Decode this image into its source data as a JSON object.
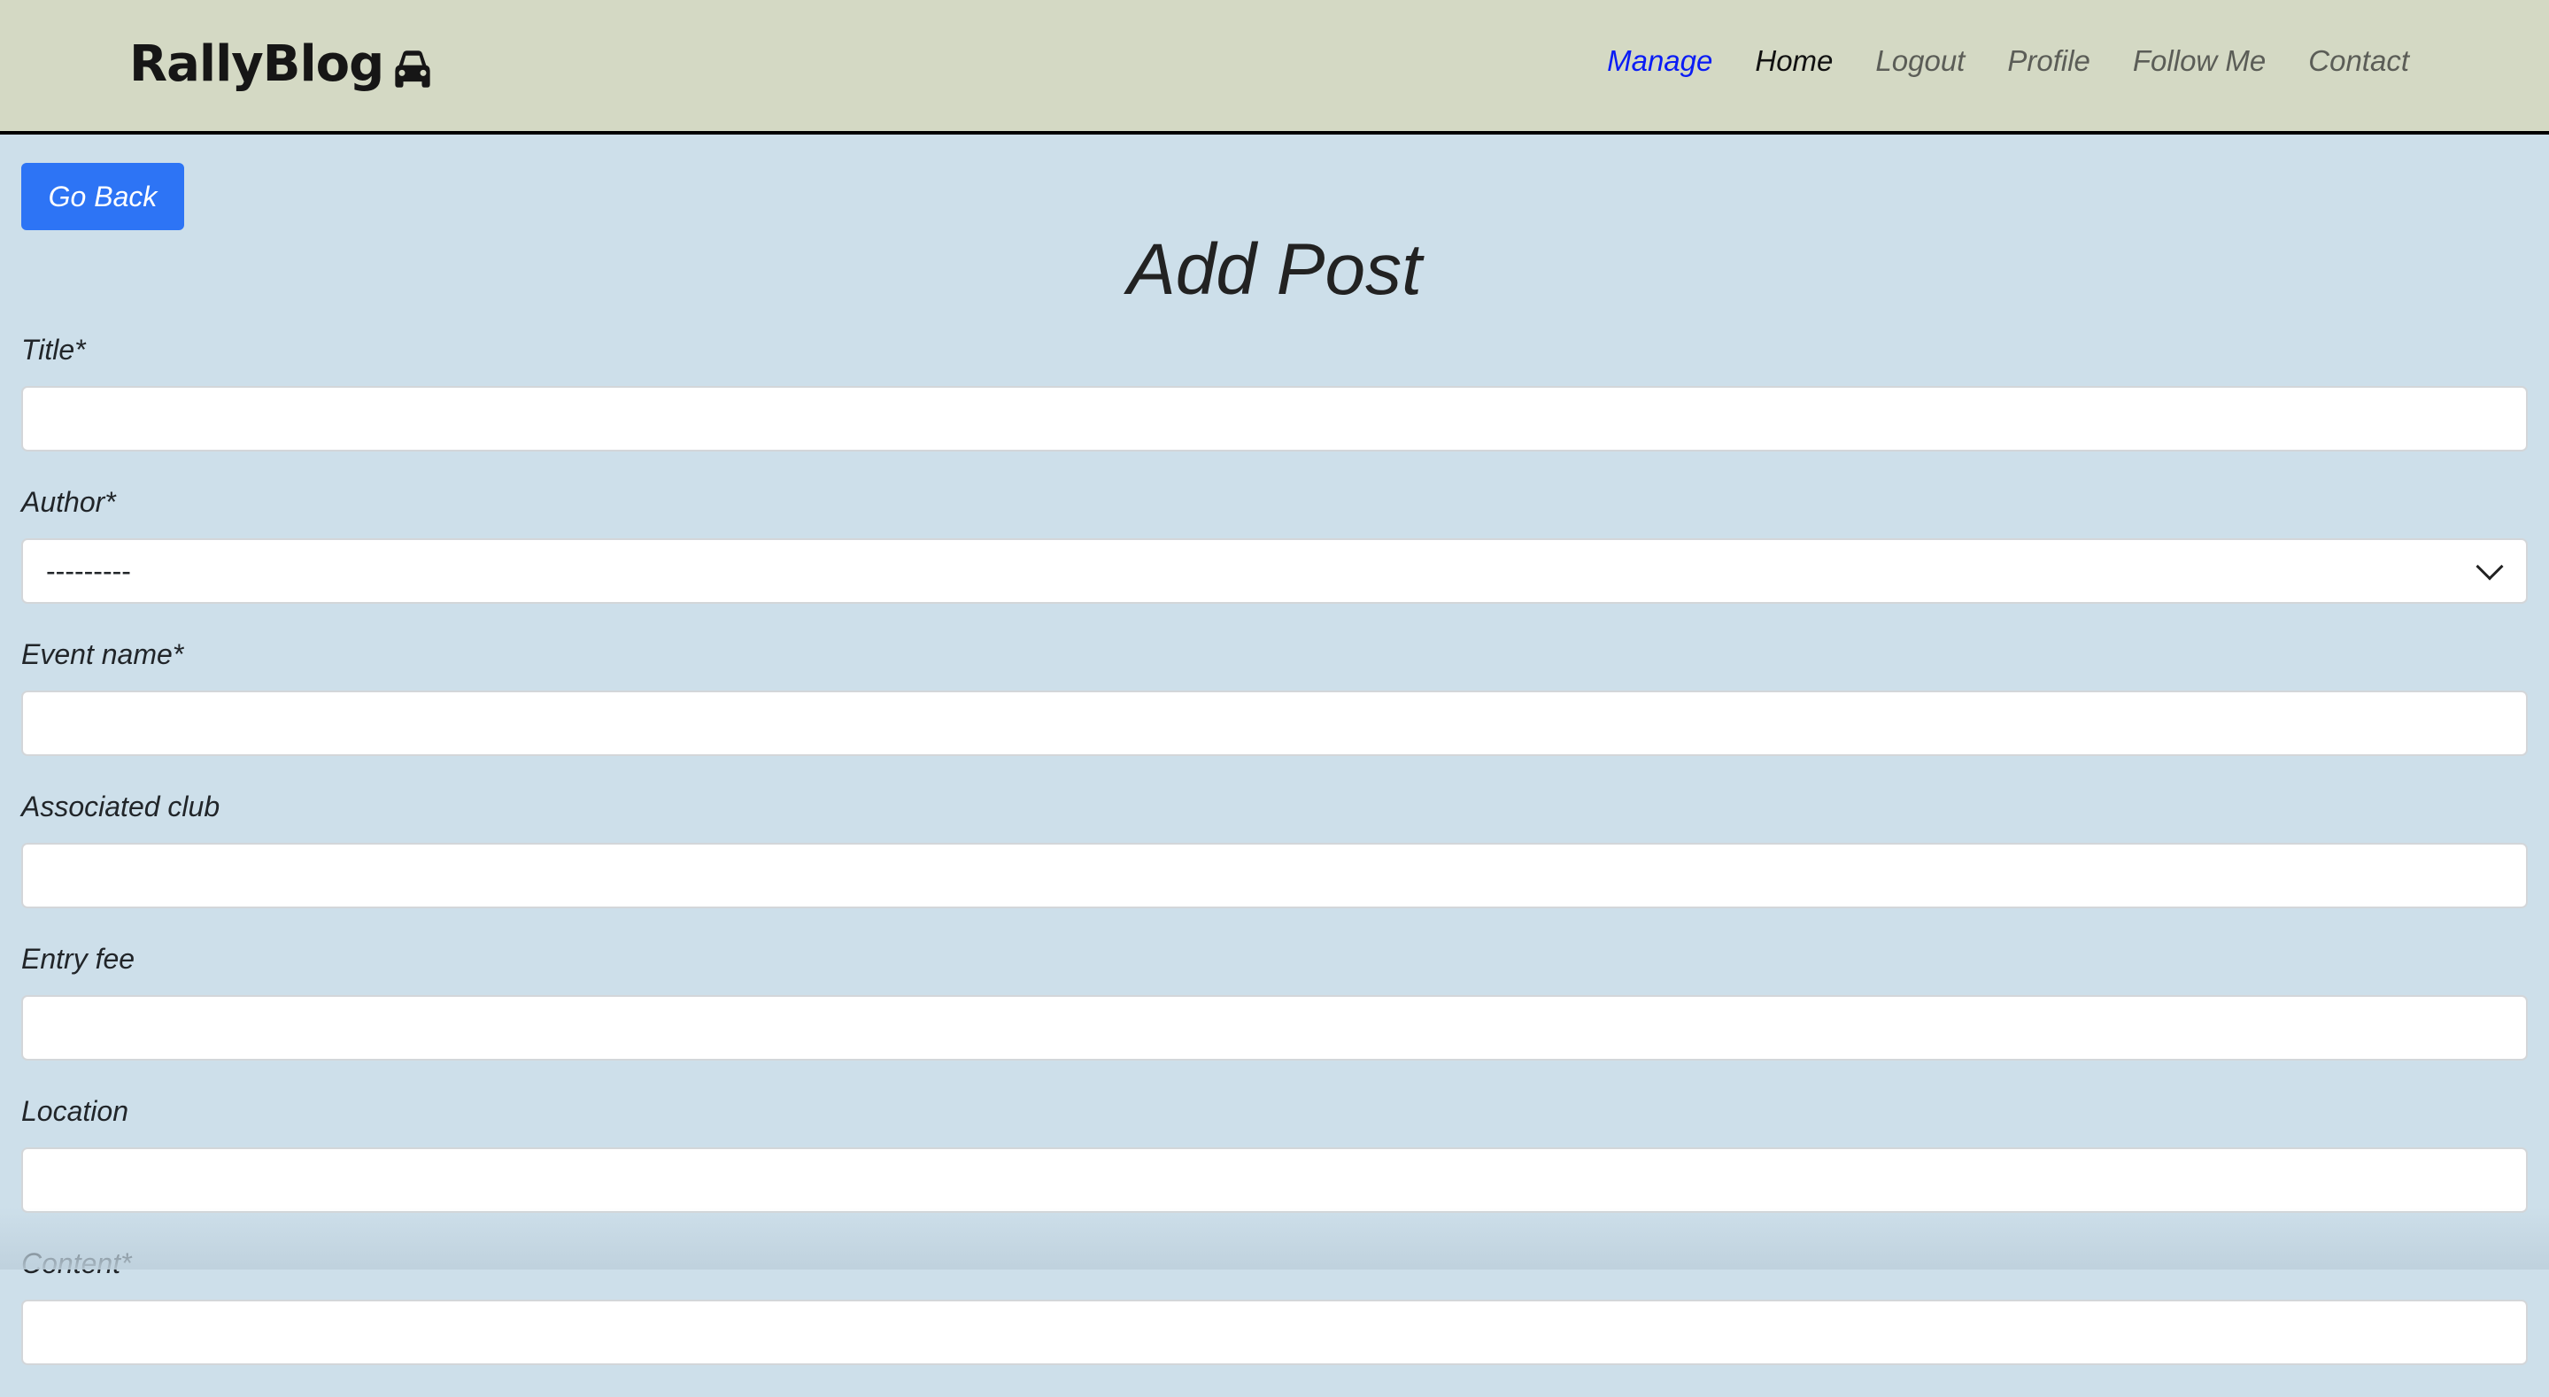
{
  "header": {
    "logo": "RallyBlog",
    "nav": [
      "Manage",
      "Home",
      "Logout",
      "Profile",
      "Follow Me",
      "Contact"
    ]
  },
  "go_back": "Go Back",
  "page_title": "Add Post",
  "fields": [
    {
      "label": "Title*",
      "value": ""
    },
    {
      "label": "Author*",
      "value": "---------"
    },
    {
      "label": "Event name*",
      "value": ""
    },
    {
      "label": "Associated club",
      "value": ""
    },
    {
      "label": "Entry fee",
      "value": ""
    },
    {
      "label": "Location",
      "value": ""
    },
    {
      "label": "Content*",
      "value": ""
    }
  ],
  "colors": {
    "header_bg": "#d4d9c4",
    "page_bg": "#cddfea",
    "button": "#2d74f5",
    "active_nav": "#0a1cf5"
  }
}
